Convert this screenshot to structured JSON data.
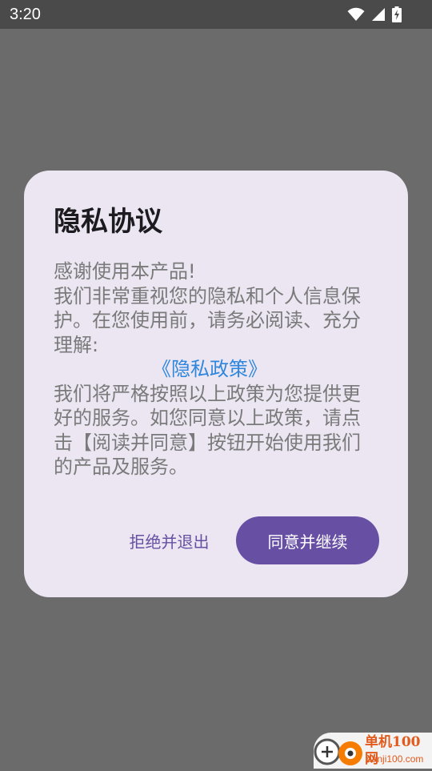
{
  "status_bar": {
    "time": "3:20",
    "icons": [
      "wifi-icon",
      "cellular-signal-icon",
      "battery-charging-icon"
    ]
  },
  "dialog": {
    "title": "隐私协议",
    "body": {
      "line_1": "感谢使用本产品!",
      "paragraph_1": "我们非常重视您的隐私和个人信息保护。在您使用前，请务必阅读、充分理解:",
      "policy_link": "《隐私政策》",
      "paragraph_2": "我们将严格按照以上政策为您提供更好的服务。如您同意以上政策，请点击【阅读并同意】按钮开始使用我们的产品及服务。"
    },
    "buttons": {
      "reject": "拒绝并退出",
      "agree": "同意并继续"
    }
  },
  "watermark": {
    "name": "单机100网",
    "url": "danji100.com"
  },
  "colors": {
    "scrim": "#6b6b6b",
    "status_bar": "#4a4a4a",
    "dialog_background": "#ebe6f1",
    "primary": "#6750a4",
    "link": "#2e86de",
    "body_text": "#7a7a7a",
    "watermark": "#e25a1c"
  }
}
